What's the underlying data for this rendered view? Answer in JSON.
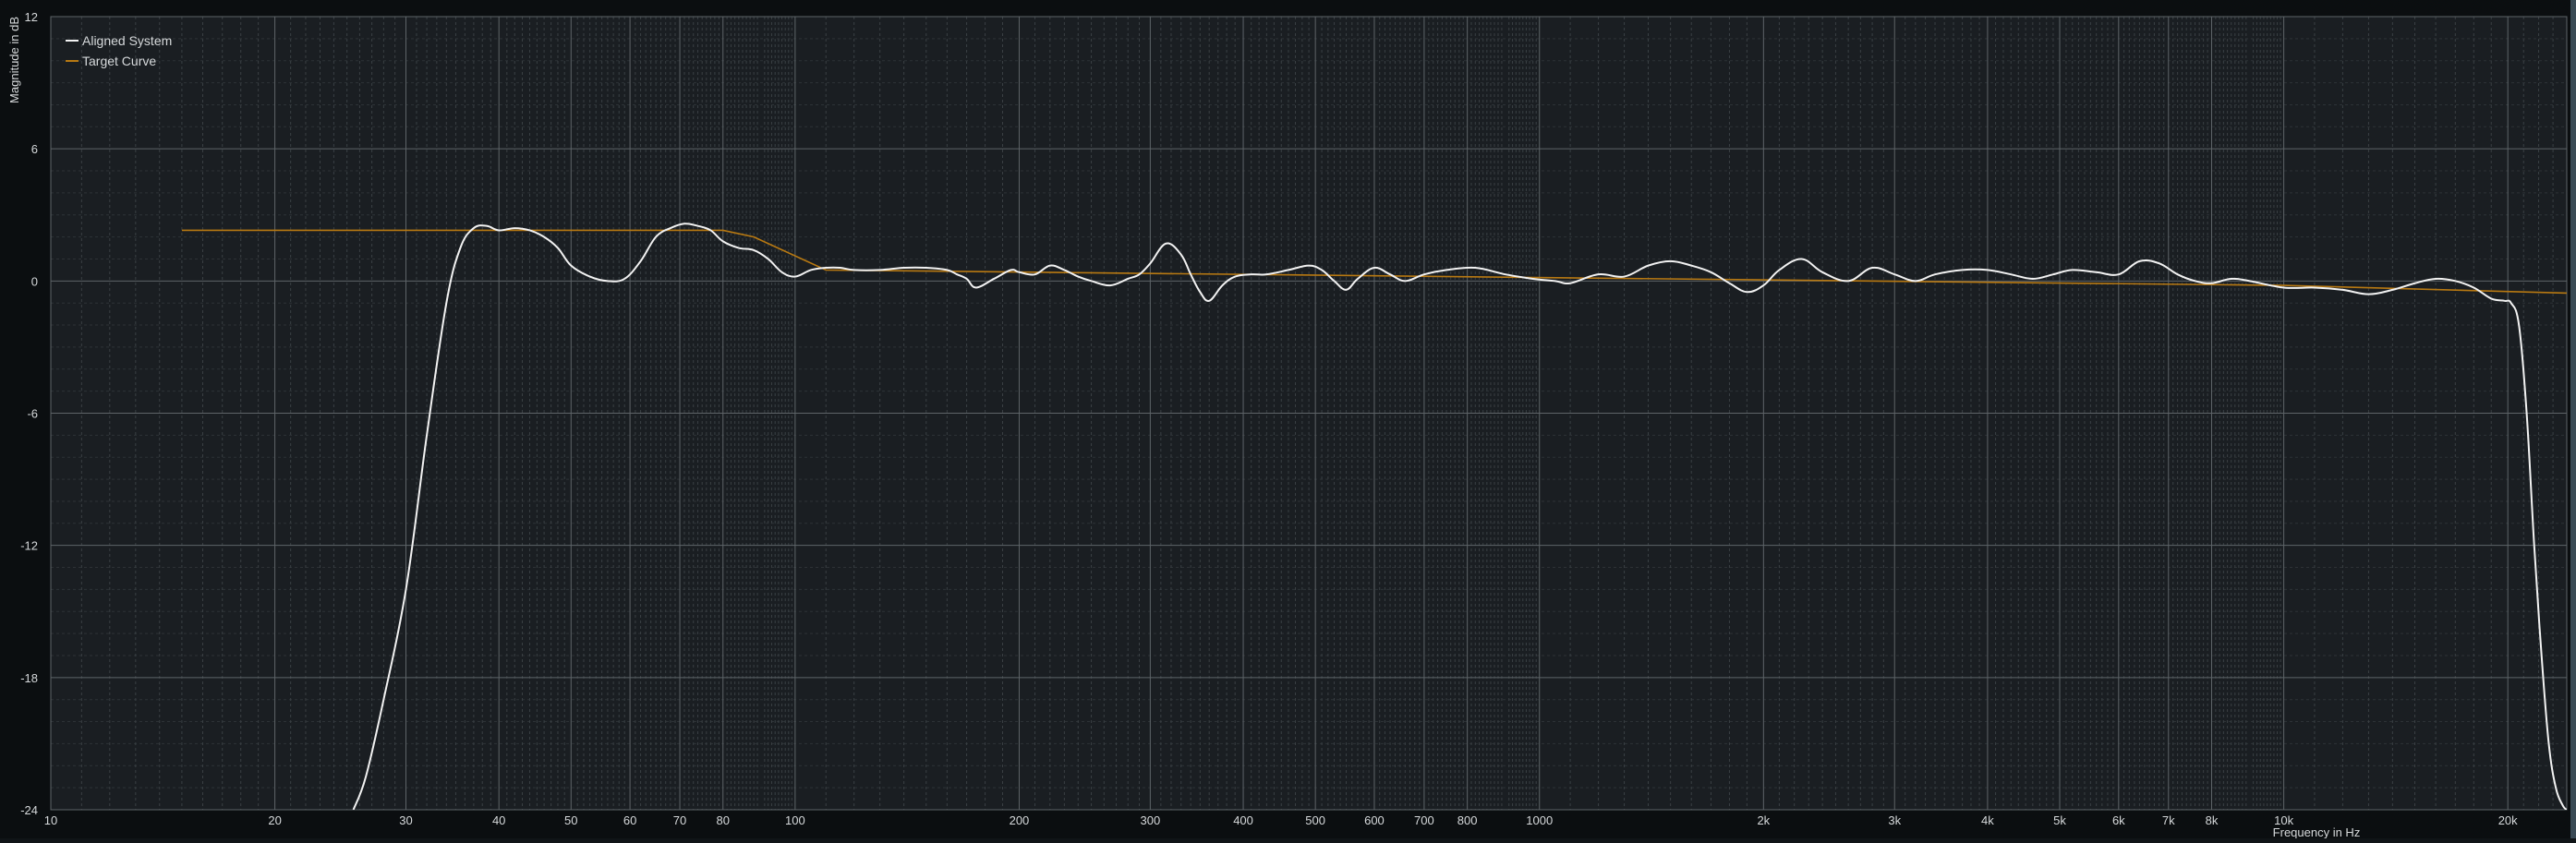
{
  "chart_data": {
    "type": "line",
    "title": "",
    "xlabel": "Frequency in Hz",
    "ylabel": "Magnitude in dB",
    "x_scale": "log",
    "xlim": [
      10,
      24000
    ],
    "ylim": [
      -24,
      12
    ],
    "y_ticks": [
      12,
      6,
      0,
      -6,
      -12,
      -18,
      -24
    ],
    "y_tick_labels": [
      "12",
      "6",
      "0",
      "-6",
      "-12",
      "-18",
      "-24"
    ],
    "x_ticks": [
      10,
      20,
      30,
      40,
      50,
      60,
      70,
      80,
      100,
      200,
      300,
      400,
      500,
      600,
      700,
      800,
      1000,
      2000,
      3000,
      4000,
      5000,
      6000,
      7000,
      8000,
      10000,
      20000
    ],
    "x_tick_labels": [
      "10",
      "20",
      "30",
      "40",
      "50",
      "60",
      "70",
      "80",
      "100",
      "200",
      "300",
      "400",
      "500",
      "600",
      "700",
      "800",
      "1000",
      "2k",
      "3k",
      "4k",
      "5k",
      "6k",
      "7k",
      "8k",
      "10k",
      "20k"
    ],
    "grid": true,
    "legend_position": "top-left",
    "colors": {
      "background": "#1a1e22",
      "frame": "#0b0e10",
      "grid_major": "#5e6468",
      "grid_minor": "#3a4044",
      "text": "#d6d9db",
      "aligned": "#f2f2f2",
      "target": "#b87912"
    },
    "series": [
      {
        "name": "Aligned System",
        "color": "#f2f2f2",
        "x": [
          25.5,
          26.5,
          28,
          30,
          32,
          34,
          35.5,
          37,
          38.5,
          40,
          42,
          44,
          46,
          48,
          50,
          53,
          56,
          59,
          62,
          65,
          68,
          71,
          74,
          77,
          80,
          84,
          88,
          92,
          96,
          100,
          105,
          110,
          115,
          120,
          130,
          140,
          150,
          160,
          165,
          170,
          175,
          185,
          195,
          200,
          210,
          220,
          230,
          240,
          250,
          265,
          280,
          290,
          300,
          315,
          330,
          340,
          350,
          360,
          375,
          390,
          410,
          430,
          460,
          490,
          510,
          530,
          550,
          570,
          600,
          630,
          660,
          700,
          750,
          820,
          900,
          980,
          1050,
          1100,
          1200,
          1300,
          1400,
          1500,
          1600,
          1700,
          1800,
          1900,
          2000,
          2100,
          2250,
          2400,
          2600,
          2800,
          3000,
          3200,
          3400,
          3700,
          4000,
          4300,
          4600,
          4900,
          5200,
          5600,
          6000,
          6400,
          6800,
          7200,
          7600,
          8000,
          8500,
          9000,
          10000,
          11000,
          12000,
          13000,
          14000,
          15000,
          16000,
          17000,
          18000,
          19000,
          19800,
          20200,
          20700,
          21200,
          21700,
          22200,
          22700,
          23200,
          23700,
          24000
        ],
        "y": [
          -24,
          -22.5,
          -19,
          -14,
          -7,
          -1,
          1.5,
          2.4,
          2.5,
          2.3,
          2.4,
          2.3,
          2.0,
          1.5,
          0.7,
          0.2,
          0.0,
          0.1,
          0.9,
          2.0,
          2.4,
          2.6,
          2.5,
          2.3,
          1.8,
          1.5,
          1.4,
          1.0,
          0.4,
          0.2,
          0.5,
          0.6,
          0.6,
          0.5,
          0.5,
          0.6,
          0.6,
          0.5,
          0.3,
          0.1,
          -0.3,
          0.1,
          0.5,
          0.4,
          0.3,
          0.7,
          0.5,
          0.2,
          0.0,
          -0.2,
          0.1,
          0.3,
          0.8,
          1.7,
          1.2,
          0.3,
          -0.5,
          -0.9,
          -0.2,
          0.2,
          0.3,
          0.3,
          0.5,
          0.7,
          0.5,
          0.0,
          -0.4,
          0.1,
          0.6,
          0.3,
          0.0,
          0.3,
          0.5,
          0.6,
          0.3,
          0.1,
          0.0,
          -0.1,
          0.3,
          0.2,
          0.7,
          0.9,
          0.7,
          0.4,
          -0.1,
          -0.5,
          -0.2,
          0.5,
          1.0,
          0.4,
          0.0,
          0.6,
          0.3,
          0.0,
          0.3,
          0.5,
          0.5,
          0.3,
          0.1,
          0.3,
          0.5,
          0.4,
          0.3,
          0.9,
          0.8,
          0.3,
          0.0,
          -0.1,
          0.1,
          0.0,
          -0.3,
          -0.3,
          -0.4,
          -0.6,
          -0.4,
          -0.1,
          0.1,
          0.0,
          -0.3,
          -0.8,
          -0.9,
          -1.0,
          -2.0,
          -6.0,
          -12.0,
          -17.0,
          -21.0,
          -23.0,
          -23.8,
          -24
        ]
      },
      {
        "name": "Target Curve",
        "color": "#b87912",
        "x": [
          15,
          80,
          88,
          110,
          10000,
          24000
        ],
        "y": [
          2.3,
          2.3,
          2.0,
          0.5,
          -0.2,
          -0.55
        ]
      }
    ]
  }
}
